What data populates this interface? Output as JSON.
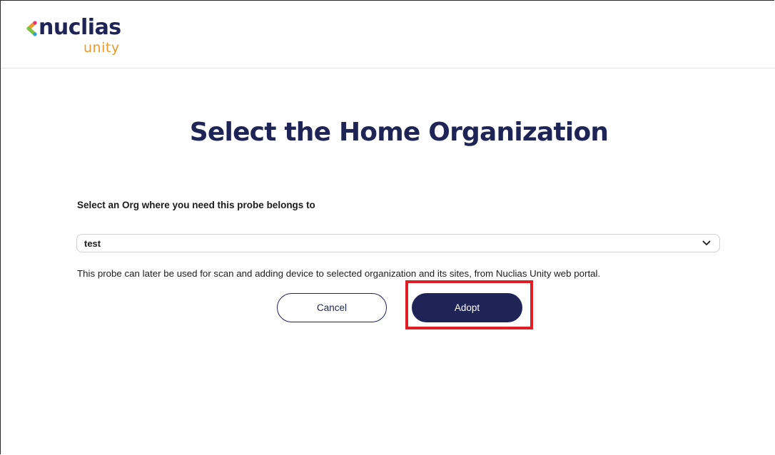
{
  "brand": {
    "name": "nuclias",
    "product": "unity",
    "colors": {
      "primary": "#1f2456",
      "accent_orange": "#e99a2c",
      "highlight_red": "#e01e26"
    },
    "mark_icon": "chevron-left-multicolor-icon"
  },
  "page": {
    "title": "Select the Home Organization"
  },
  "form": {
    "prompt": "Select an Org where you need this probe belongs to",
    "org_select": {
      "value": "test",
      "icon": "chevron-down-icon"
    },
    "description": "This probe can later be used for scan and adding device to selected organization and its sites, from Nuclias Unity web portal."
  },
  "actions": {
    "cancel_label": "Cancel",
    "adopt_label": "Adopt"
  }
}
